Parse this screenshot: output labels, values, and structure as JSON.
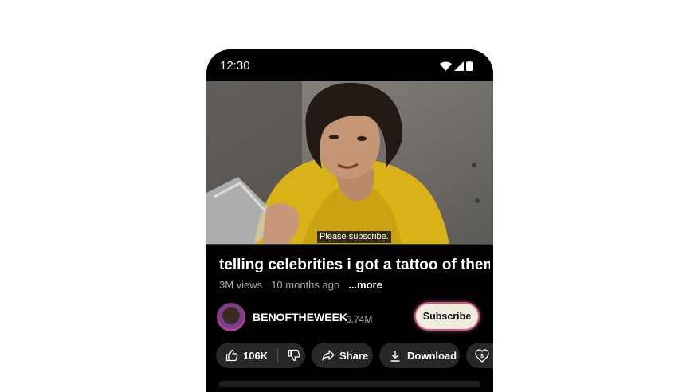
{
  "status_bar": {
    "time": "12:30"
  },
  "video": {
    "caption": "Please subscribe."
  },
  "details": {
    "title": "telling celebrities i got a tattoo of them...",
    "views": "3M views",
    "age": "10 months ago",
    "more_label": "...more"
  },
  "channel": {
    "name": "BENOFTHEWEEK",
    "subscribers": "6.74M",
    "subscribe_label": "Subscribe"
  },
  "actions": {
    "like_count": "106K",
    "share_label": "Share",
    "download_label": "Download"
  },
  "colors": {
    "accent_subscribe_bg": "#f1ece0",
    "subscribe_glow": "#d8567f",
    "pill_bg": "#272727"
  }
}
